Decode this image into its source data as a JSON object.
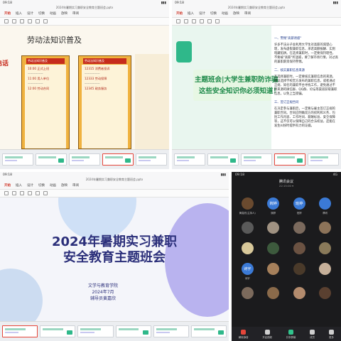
{
  "q1": {
    "status_time": "09:18",
    "filename": "2024年暑期实习兼职安全教育主题班会.pptx",
    "tabs": [
      "开始",
      "插入",
      "设计",
      "切换",
      "动画",
      "放映",
      "审阅"
    ],
    "slide_title": "劳动法知识普及",
    "left_red_text": "电话",
    "card1_header": "劳动法知识普及",
    "card1_lines": [
      "10:00 正式上班",
      "11:00 用人单位",
      "12:00 劳动合同"
    ],
    "card2_header": "劳动法知识普及",
    "card2_lines": [
      "12315 消费者投诉",
      "12333 劳动保障",
      "12345 政务服务"
    ]
  },
  "q2": {
    "status_time": "09:18",
    "filename": "2024年暑期实习兼职安全教育主题班会.pptx",
    "tabs": [
      "开始",
      "插入",
      "设计",
      "切换",
      "动画",
      "放映",
      "审阅"
    ],
    "banner_line1": "主题班会|大学生兼职防诈骗",
    "banner_line2": "这些安全知识你必须知道！",
    "h1": "一、警惕\"高薪诱惑\"",
    "p1": "许多不法分子会利用大学生对高薪的渴望心理，发布虚假兼职信息，承诺高额报酬、实则暗藏陷阱。在选择兼职时，一定要保持理性，不要被\"高薪\"所迷惑，要了解市场行情，对过高的兼职薪资保持警惕。",
    "h2": "二、核实兼职信息来源",
    "p2": "在选择兼职时，一定要核实兼职信息的来源，建议选择学校官方发布的兼职信息，或者通过正规、知名的兼职平台寻找工作，避免通过不明来源的微信群、QQ群、论坛等渠道获取兼职信息，以免上当受骗。",
    "h3": "三、签订正规合同",
    "p3": "在决定参与兼职后，一定要与雇主签订正规的兼职合同。合同应明确双方的权利和义务、包括工作内容、工作时间、薪酬标准、安全保障等，这不仅可以保障自己的合法权益，还能在发生纠纷时提供有力的证据。"
  },
  "q3": {
    "status_time": "09:18",
    "filename": "2024年暑期实习兼职安全教育主题班会.pptx",
    "tabs": [
      "开始",
      "插入",
      "设计",
      "切换",
      "动画",
      "放映",
      "审阅"
    ],
    "title_line1": "2024年暑期实习兼职",
    "title_line2": "安全教育主题班会",
    "college": "文学与教育学院",
    "date": "2024年7月",
    "counselor": "辅导员黄嘉欣"
  },
  "q4": {
    "status_time": "09:18",
    "status_right": "4G",
    "meeting_title": "腾讯会议",
    "meeting_sub": "22:15:00 ▾",
    "participants": [
      {
        "label": "",
        "name": "黄嘉欣(主持人)",
        "color": "#6a4a2f"
      },
      {
        "label": "婉婷",
        "name": "婉婷",
        "color": "#3b7ad6"
      },
      {
        "label": "班婷",
        "name": "班婷",
        "color": "#3b7ad6"
      },
      {
        "label": "",
        "name": "腾讯",
        "color": "#3b7ad6"
      },
      {
        "label": "",
        "name": "",
        "color": "#5a5a5a"
      },
      {
        "label": "",
        "name": "",
        "color": "#a09282"
      },
      {
        "label": "",
        "name": "",
        "color": "#7b6a5d"
      },
      {
        "label": "",
        "name": "",
        "color": "#8c7359"
      },
      {
        "label": "",
        "name": "",
        "color": "#d8c89a"
      },
      {
        "label": "",
        "name": "",
        "color": "#3d5a3d"
      },
      {
        "label": "",
        "name": "",
        "color": "#6b5242"
      },
      {
        "label": "",
        "name": "",
        "color": "#8a7a5a"
      },
      {
        "label": "诗宇",
        "name": "诗宇",
        "color": "#3b7ad6"
      },
      {
        "label": "",
        "name": "",
        "color": "#a6805b"
      },
      {
        "label": "",
        "name": "",
        "color": "#4a3a2a"
      },
      {
        "label": "",
        "name": "",
        "color": "#c6b09a"
      },
      {
        "label": "",
        "name": "",
        "color": "#7c6a5c"
      },
      {
        "label": "",
        "name": "",
        "color": "#8a6a4a"
      },
      {
        "label": "",
        "name": "",
        "color": "#b38b6d"
      },
      {
        "label": "",
        "name": "",
        "color": "#5a4030"
      }
    ],
    "bottom": [
      "解除静音",
      "开启视频",
      "共享屏幕",
      "成员",
      "更多"
    ]
  }
}
